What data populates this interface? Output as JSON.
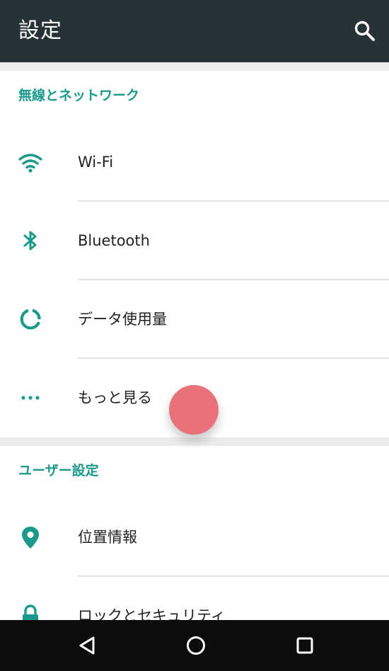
{
  "app_bar": {
    "title": "設定",
    "search_icon": "search-icon",
    "background_color": "#263238"
  },
  "accent_color": "#1b998b",
  "sections": [
    {
      "header": "無線とネットワーク",
      "items": [
        {
          "label": "Wi-Fi",
          "icon": "wifi-icon"
        },
        {
          "label": "Bluetooth",
          "icon": "bluetooth-icon"
        },
        {
          "label": "データ使用量",
          "icon": "data-usage-icon"
        },
        {
          "label": "もっと見る",
          "icon": "more-dots-icon"
        }
      ]
    },
    {
      "header": "ユーザー設定",
      "items": [
        {
          "label": "位置情報",
          "icon": "location-pin-icon"
        },
        {
          "label": "ロックとセキュリティ",
          "icon": "lock-icon"
        }
      ]
    }
  ],
  "touch_indicator_color": "#e9727a",
  "nav_bar": {
    "back_icon": "back-triangle-icon",
    "home_icon": "home-circle-icon",
    "recents_icon": "recents-square-icon"
  }
}
